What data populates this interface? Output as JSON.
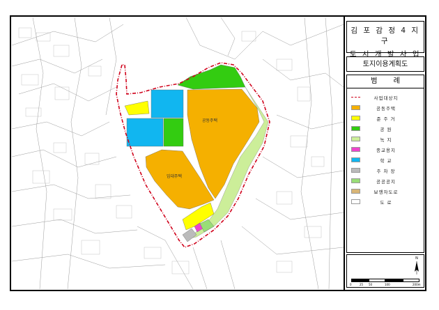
{
  "title": {
    "line1": "김 포  감 정 4 지 구",
    "line2": "도 시 개 발 사 업"
  },
  "subtitle": "토지이용계획도",
  "legend": {
    "heading": "범 례",
    "items": [
      {
        "label": "사업대상지",
        "color": "#d0021b",
        "style": "dashed-line"
      },
      {
        "label": "공동주택",
        "color": "#f5b000"
      },
      {
        "label": "준 주 거",
        "color": "#ffff00"
      },
      {
        "label": "공    원",
        "color": "#33cc11"
      },
      {
        "label": "녹    지",
        "color": "#ccee99"
      },
      {
        "label": "종교용지",
        "color": "#ee44cc"
      },
      {
        "label": "학    교",
        "color": "#11b6f0"
      },
      {
        "label": "주 차 장",
        "color": "#bbbbbb"
      },
      {
        "label": "공공공지",
        "color": "#99dd77"
      },
      {
        "label": "보행자도로",
        "color": "#d9b676"
      },
      {
        "label": "도    로",
        "color": "#ffffff"
      }
    ]
  },
  "map": {
    "labels": {
      "apartment": "공동주택",
      "rental_housing": "임대주택"
    }
  },
  "north_arrow": {
    "label": "N"
  },
  "scale": {
    "ticks": [
      "0",
      "25",
      "50",
      "100",
      "200m"
    ]
  },
  "colors": {
    "boundary": "#d0021b",
    "apartment": "#f5b000",
    "semi_residential": "#ffff00",
    "park": "#33cc11",
    "green": "#ccee99",
    "religious": "#ee44cc",
    "school": "#11b6f0",
    "parking": "#bbbbbb",
    "public_space": "#99dd77"
  }
}
